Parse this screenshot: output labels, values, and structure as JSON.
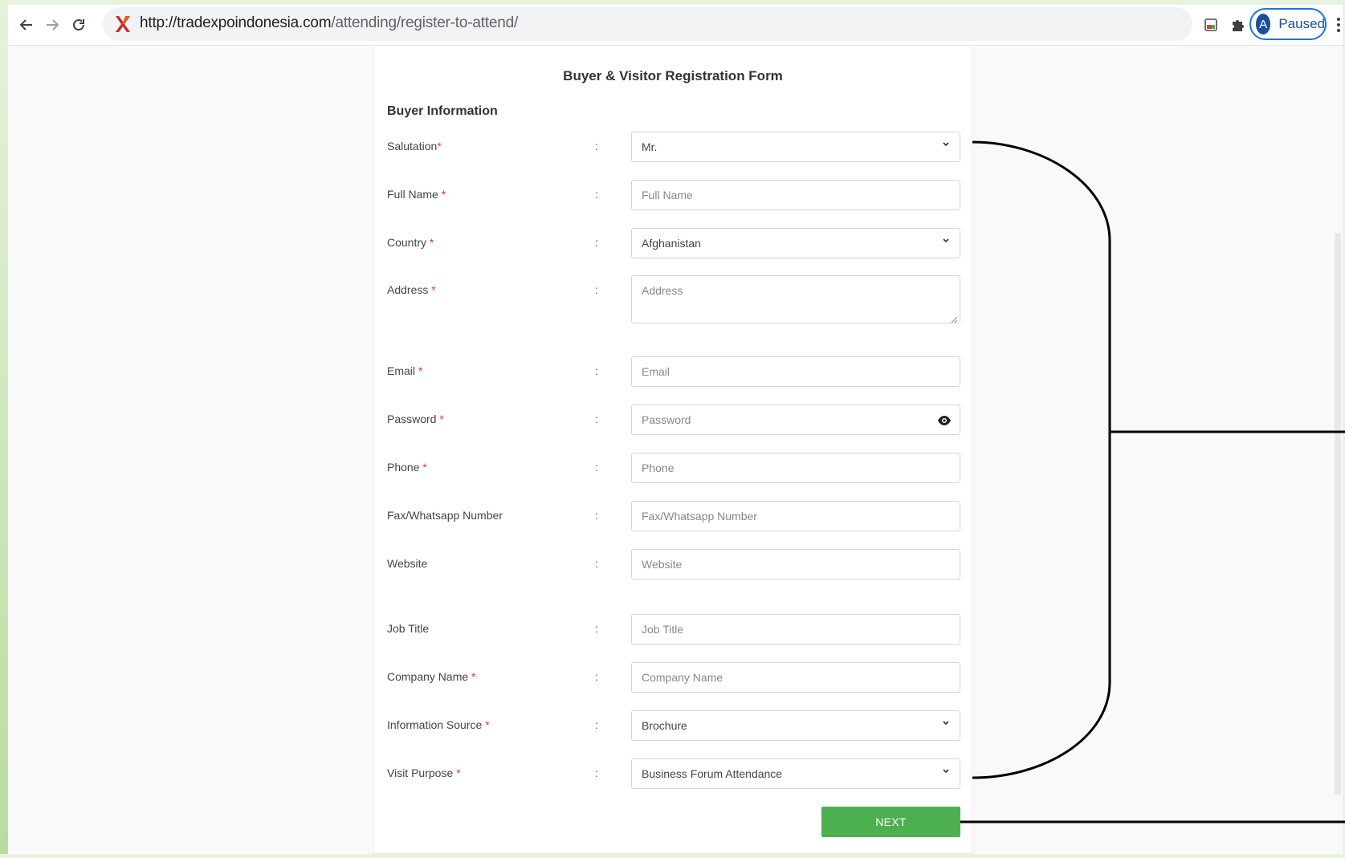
{
  "browser": {
    "url_host": "http://tradexpoindonesia.com",
    "url_path": "/attending/register-to-attend/",
    "profile_initial": "A",
    "profile_status": "Paused"
  },
  "form": {
    "title": "Buyer & Visitor Registration Form",
    "section": "Buyer Information",
    "required_mark": "*",
    "colon": ":",
    "fields": {
      "salutation": {
        "label": "Salutation",
        "value": "Mr."
      },
      "full_name": {
        "label": "Full Name ",
        "placeholder": "Full Name"
      },
      "country": {
        "label": "Country ",
        "value": "Afghanistan"
      },
      "address": {
        "label": "Address ",
        "placeholder": "Address"
      },
      "email": {
        "label": "Email ",
        "placeholder": "Email"
      },
      "password": {
        "label": "Password ",
        "placeholder": "Password"
      },
      "phone": {
        "label": "Phone ",
        "placeholder": "Phone"
      },
      "fax": {
        "label": "Fax/Whatsapp Number",
        "placeholder": "Fax/Whatsapp Number"
      },
      "website": {
        "label": "Website",
        "placeholder": "Website"
      },
      "job_title": {
        "label": "Job Title",
        "placeholder": "Job Title"
      },
      "company": {
        "label": "Company Name ",
        "placeholder": "Company Name"
      },
      "info_source": {
        "label": "Information Source ",
        "value": "Brochure"
      },
      "visit_purpose": {
        "label": "Visit Purpose ",
        "value": "Business Forum Attendance"
      }
    },
    "next_label": "NEXT"
  },
  "colors": {
    "next_button": "#4caf50",
    "required": "#e53935",
    "profile_ring": "#1a73e8"
  }
}
